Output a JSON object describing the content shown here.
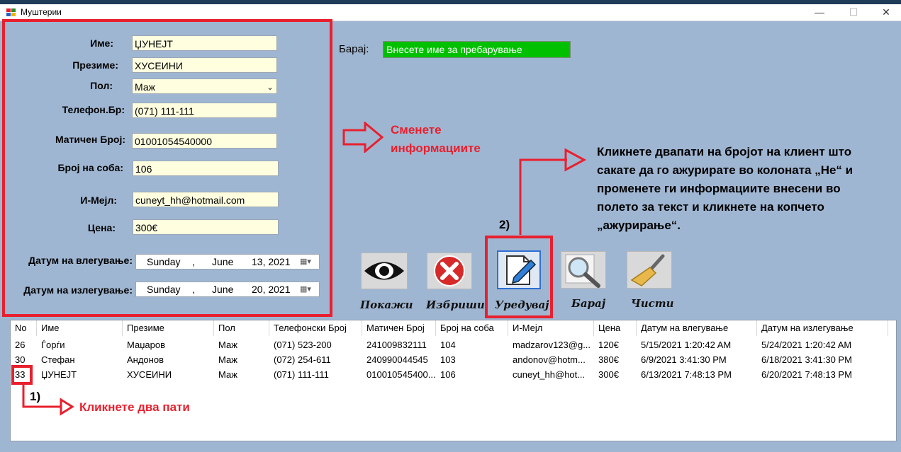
{
  "window": {
    "title": "Муштерии",
    "minimize": "—",
    "maximize": "☐",
    "close": "✕"
  },
  "form": {
    "fields": [
      {
        "label": "Име:",
        "value": "ЏУНЕЈТ"
      },
      {
        "label": "Презиме:",
        "value": "ХУСЕИНИ"
      },
      {
        "label": "Пол:",
        "value": "Маж"
      },
      {
        "label": "Телефон.Бр:",
        "value": "(071) 111-111"
      },
      {
        "label": "Матичен Број:",
        "value": "01001054540000"
      },
      {
        "label": "Број на соба:",
        "value": "106"
      },
      {
        "label": "И-Мејл:",
        "value": "cuneyt_hh@hotmail.com"
      },
      {
        "label": "Цена:",
        "value": "300€"
      }
    ],
    "checkin": {
      "label": "Датум на влегување:",
      "day": "Sunday",
      "sep": ",",
      "month": "June",
      "date": "13, 2021"
    },
    "checkout": {
      "label": "Датум на излегување:",
      "day": "Sunday",
      "sep": ",",
      "month": "June",
      "date": "20, 2021"
    }
  },
  "search": {
    "label": "Барај:",
    "value": "Внесете име за пребарување"
  },
  "annotations": {
    "change_info_line1": "Сменете",
    "change_info_line2": "информациите",
    "step2": "2)",
    "step1": "1)",
    "double_click": "Кликнете два пати",
    "instruction_lines": [
      "Кликнете двапати на бројот на клиент што",
      "сакате да го ажурирате во колоната „Не“ и",
      "променете ги информациите внесени во",
      "полето за текст и кликнете на копчето",
      "„ажурирање“."
    ]
  },
  "toolbar": [
    {
      "label": "Покажи",
      "icon": "eye-icon"
    },
    {
      "label": "Избриши",
      "icon": "delete-icon"
    },
    {
      "label": "Уредувај",
      "icon": "edit-icon"
    },
    {
      "label": "Барај",
      "icon": "magnifier-icon"
    },
    {
      "label": "Чисти",
      "icon": "broom-icon"
    }
  ],
  "grid": {
    "columns": [
      "No",
      "Име",
      "Презиме",
      "Пол",
      "Телефонски Број",
      "Матичен Број",
      "Број на соба",
      "И-Мејл",
      "Цена",
      "Датум на влегување",
      "Датум на излегување"
    ],
    "rows": [
      [
        "26",
        "Ѓорѓи",
        "Маџаров",
        "Маж",
        "(071) 523-200",
        "241009832111",
        "104",
        "madzarov123@g...",
        "120€",
        "5/15/2021 1:20:42 AM",
        "5/24/2021 1:20:42 AM"
      ],
      [
        "30",
        "Стефан",
        "Андонов",
        "Маж",
        "(072) 254-611",
        "240990044545",
        "103",
        "andonov@hotm...",
        "380€",
        "6/9/2021 3:41:30 PM",
        "6/18/2021 3:41:30 PM"
      ],
      [
        "33",
        "ЏУНЕЈТ",
        "ХУСЕИНИ",
        "Маж",
        "(071) 111-111",
        "010010545400...",
        "106",
        "cuneyt_hh@hot...",
        "300€",
        "6/13/2021 7:48:13 PM",
        "6/20/2021 7:48:13 PM"
      ]
    ]
  },
  "colors": {
    "accent_red": "#e8202e",
    "search_bg": "#00c000",
    "client_bg": "#9fb6d2",
    "textbox_bg": "#ffffe0"
  }
}
